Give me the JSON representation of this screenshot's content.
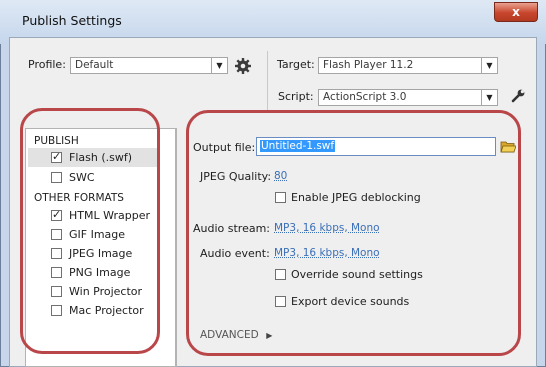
{
  "window": {
    "title": "Publish Settings",
    "close_glyph": "x"
  },
  "profile": {
    "label": "Profile:",
    "value": "Default"
  },
  "target": {
    "label": "Target:",
    "value": "Flash Player 11.2"
  },
  "script": {
    "label": "Script:",
    "value": "ActionScript 3.0"
  },
  "left_panel": {
    "publish_header": "PUBLISH",
    "publish_items": [
      {
        "label": "Flash (.swf)",
        "checked": true
      },
      {
        "label": "SWC",
        "checked": false
      }
    ],
    "other_header": "OTHER FORMATS",
    "other_items": [
      {
        "label": "HTML Wrapper",
        "checked": true
      },
      {
        "label": "GIF Image",
        "checked": false
      },
      {
        "label": "JPEG Image",
        "checked": false
      },
      {
        "label": "PNG Image",
        "checked": false
      },
      {
        "label": "Win Projector",
        "checked": false
      },
      {
        "label": "Mac Projector",
        "checked": false
      }
    ]
  },
  "settings": {
    "output_file_label": "Output file:",
    "output_file_value": "Untitled-1.swf",
    "jpeg_quality_label": "JPEG Quality:",
    "jpeg_quality_value": "80",
    "jpeg_deblocking_label": "Enable JPEG deblocking",
    "audio_stream_label": "Audio stream:",
    "audio_stream_value": "MP3, 16 kbps, Mono",
    "audio_event_label": "Audio event:",
    "audio_event_value": "MP3, 16 kbps, Mono",
    "override_sound_label": "Override sound settings",
    "export_device_label": "Export device sounds",
    "advanced_label": "ADVANCED"
  },
  "colors": {
    "annotation_ring": "#b9474a",
    "link": "#3a6fb7",
    "selection": "#3399ff"
  },
  "icons": {
    "gear": "gear-icon",
    "wrench": "wrench-icon",
    "folder": "folder-icon",
    "advanced_arrow": "triangle-right-icon"
  }
}
